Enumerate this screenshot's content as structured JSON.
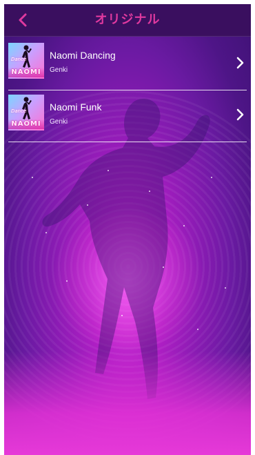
{
  "header": {
    "title": "オリジナル",
    "back_icon": "chevron-left-icon",
    "accent_color": "#e0399f"
  },
  "songs": [
    {
      "title": "Naomi Dancing",
      "artist": "Genki",
      "thumb_logo": "NAOMI",
      "thumb_script": "Dance",
      "chevron_icon": "chevron-right-icon"
    },
    {
      "title": "Naomi Funk",
      "artist": "Genki",
      "thumb_logo": "NAOMI",
      "thumb_script": "Dance",
      "chevron_icon": "chevron-right-icon"
    }
  ],
  "theme": {
    "header_bg": "#3a0f5f",
    "background_top": "#3f1275",
    "background_bottom": "#e639d8"
  }
}
